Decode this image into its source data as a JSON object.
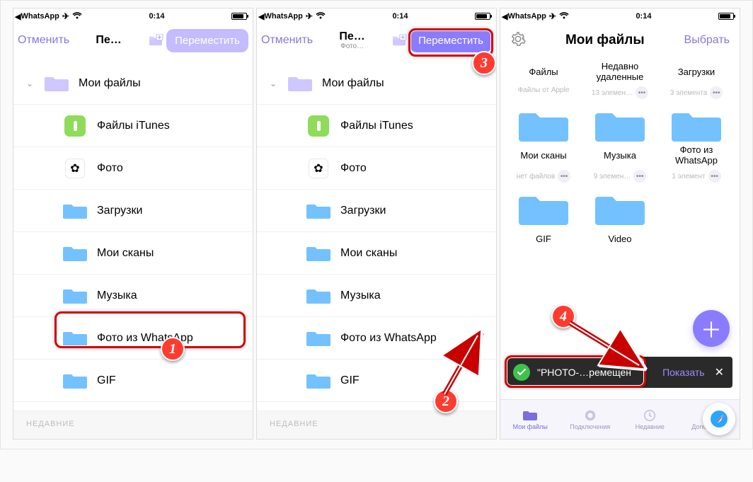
{
  "status": {
    "app": "WhatsApp",
    "time": "0:14"
  },
  "s1": {
    "cancel": "Отменить",
    "title": "Пе…",
    "move_btn": "Переместить",
    "root": "Мои файлы",
    "items": [
      {
        "label": "Файлы iTunes"
      },
      {
        "label": "Фото"
      },
      {
        "label": "Загрузки"
      },
      {
        "label": "Мои сканы"
      },
      {
        "label": "Музыка"
      },
      {
        "label": "Фото из  WhatsApp"
      },
      {
        "label": "GIF"
      }
    ],
    "recent": "НЕДАВНИЕ"
  },
  "s2": {
    "cancel": "Отменить",
    "title": "Пе…",
    "subtitle": "Фото…",
    "move_btn": "Переместить",
    "root": "Мои файлы",
    "items": [
      {
        "label": "Файлы iTunes"
      },
      {
        "label": "Фото"
      },
      {
        "label": "Загрузки"
      },
      {
        "label": "Мои сканы"
      },
      {
        "label": "Музыка"
      },
      {
        "label": "Фото из  WhatsApp"
      },
      {
        "label": "GIF"
      }
    ],
    "recent": "НЕДАВНИЕ"
  },
  "s3": {
    "title": "Мои файлы",
    "select_btn": "Выбрать",
    "cards": [
      {
        "name": "Файлы",
        "meta": "Файлы от Apple"
      },
      {
        "name": "Недавно удаленные",
        "meta": "13 элемен…"
      },
      {
        "name": "Загрузки",
        "meta": "3 элемента"
      },
      {
        "name": "Мои сканы",
        "meta": "нет файлов"
      },
      {
        "name": "Музыка",
        "meta": "9 элемен…"
      },
      {
        "name": "Фото из WhatsApp",
        "meta": "1 элемент"
      },
      {
        "name": "GIF",
        "meta": ""
      },
      {
        "name": "Video",
        "meta": ""
      }
    ],
    "toast_msg": "\"PHOTO-…ремещен",
    "toast_show": "Показать",
    "tabs": [
      "Мои файлы",
      "Подключения",
      "Недавние",
      "Дополнения"
    ]
  }
}
